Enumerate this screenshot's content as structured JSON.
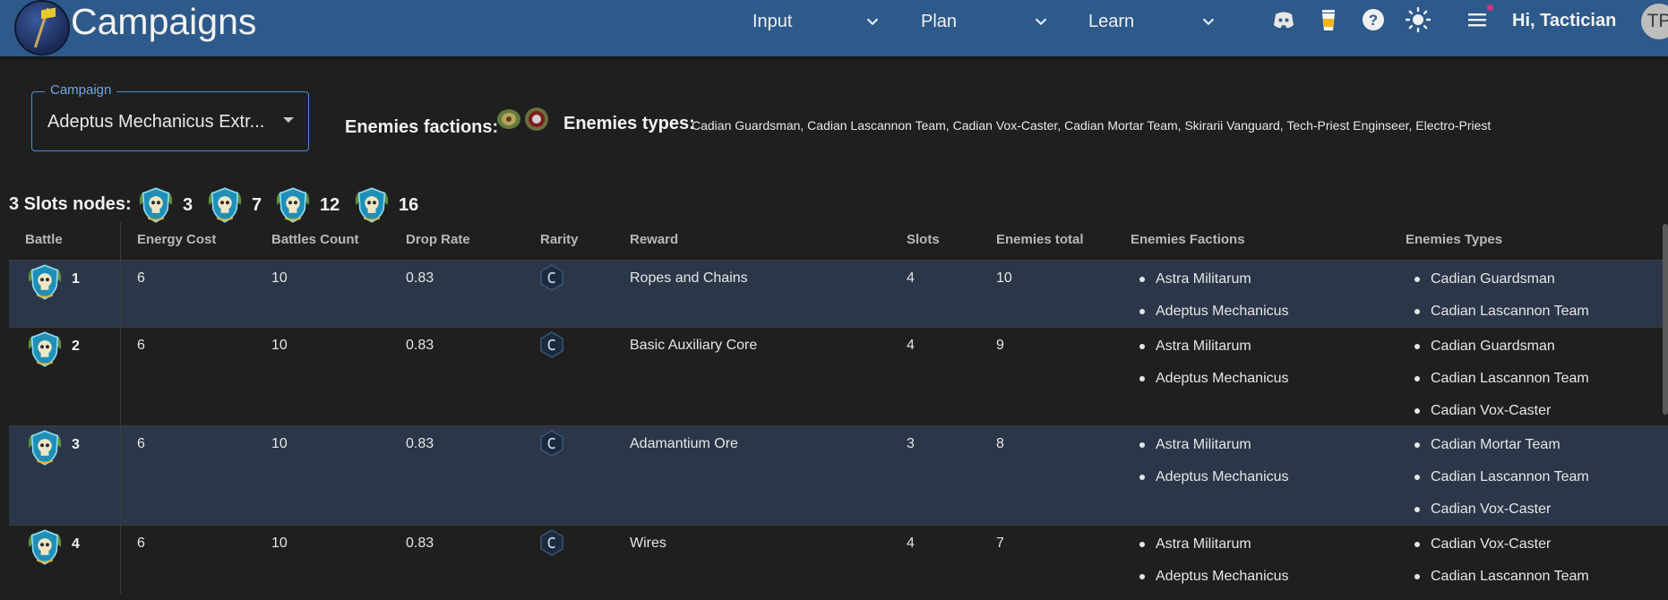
{
  "header": {
    "title": "Campaigns",
    "menus": [
      {
        "label": "Input"
      },
      {
        "label": "Plan"
      },
      {
        "label": "Learn"
      }
    ],
    "greeting": "Hi, Tactician",
    "avatar_initials": "TP",
    "icons": [
      "discord-icon",
      "coffee-cup-icon",
      "help-icon",
      "brightness-icon",
      "menu-icon"
    ],
    "accent_color": "#2d5a8a"
  },
  "campaign": {
    "legend": "Campaign",
    "selected": "Adeptus Mechanicus Extr..."
  },
  "enemies": {
    "factions_label": "Enemies factions:",
    "types_label": "Enemies types:",
    "types": "Cadian Guardsman, Cadian Lascannon Team, Cadian Vox-Caster, Cadian Mortar Team, Skirarii Vanguard, Tech-Priest Enginseer, Electro-Priest",
    "faction_icons": [
      "astra-militarum-icon",
      "adeptus-mechanicus-icon"
    ]
  },
  "slots_nodes": {
    "label": "3 Slots nodes:",
    "nodes": [
      "3",
      "7",
      "12",
      "16"
    ]
  },
  "table": {
    "columns": [
      "Battle",
      "Energy Cost",
      "Battles Count",
      "Drop Rate",
      "Rarity",
      "Reward",
      "Slots",
      "Enemies total",
      "Enemies Factions",
      "Enemies Types"
    ],
    "rows": [
      {
        "battle": "1",
        "energy": "6",
        "count": "10",
        "drop": "0.83",
        "rarity": "C",
        "reward": "Ropes and Chains",
        "slots": "4",
        "total": "10",
        "factions": [
          "Astra Militarum",
          "Adeptus Mechanicus"
        ],
        "types": [
          "Cadian Guardsman",
          "Cadian Lascannon Team"
        ]
      },
      {
        "battle": "2",
        "energy": "6",
        "count": "10",
        "drop": "0.83",
        "rarity": "C",
        "reward": "Basic Auxiliary Core",
        "slots": "4",
        "total": "9",
        "factions": [
          "Astra Militarum",
          "Adeptus Mechanicus"
        ],
        "types": [
          "Cadian Guardsman",
          "Cadian Lascannon Team",
          "Cadian Vox-Caster"
        ]
      },
      {
        "battle": "3",
        "energy": "6",
        "count": "10",
        "drop": "0.83",
        "rarity": "C",
        "reward": "Adamantium Ore",
        "slots": "3",
        "total": "8",
        "factions": [
          "Astra Militarum",
          "Adeptus Mechanicus"
        ],
        "types": [
          "Cadian Mortar Team",
          "Cadian Lascannon Team",
          "Cadian Vox-Caster"
        ]
      },
      {
        "battle": "4",
        "energy": "6",
        "count": "10",
        "drop": "0.83",
        "rarity": "C",
        "reward": "Wires",
        "slots": "4",
        "total": "7",
        "factions": [
          "Astra Militarum",
          "Adeptus Mechanicus"
        ],
        "types": [
          "Cadian Vox-Caster",
          "Cadian Lascannon Team"
        ]
      }
    ]
  }
}
